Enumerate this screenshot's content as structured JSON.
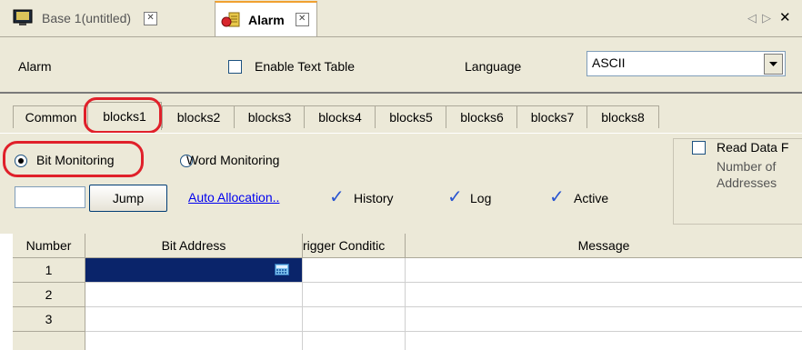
{
  "doc_tabs": [
    {
      "label": "Base 1(untitled)",
      "icon": "monitor-icon",
      "active": false
    },
    {
      "label": "Alarm",
      "icon": "alarm-icon",
      "active": true
    }
  ],
  "tab_nav": {
    "prev": "◁",
    "next": "▷",
    "close": "✕"
  },
  "settings": {
    "alarm_label": "Alarm",
    "enable_text_table_label": "Enable Text Table",
    "enable_text_table_checked": false,
    "language_label": "Language",
    "language_value": "ASCII"
  },
  "block_tabs": [
    "Common",
    "blocks1",
    "blocks2",
    "blocks3",
    "blocks4",
    "blocks5",
    "blocks6",
    "blocks7",
    "blocks8"
  ],
  "active_block_tab": "blocks1",
  "monitoring": {
    "bit_label": "Bit Monitoring",
    "word_label": "Word Monitoring",
    "selected": "bit"
  },
  "read_data": {
    "checkbox_label": "Read Data F",
    "number_of_label": "Number of",
    "addresses_label": "Addresses"
  },
  "toolbar": {
    "jump_input_value": "",
    "jump_label": "Jump",
    "auto_allocation_label": "Auto Allocation..",
    "history_label": "History",
    "log_label": "Log",
    "active_label": "Active",
    "history_checked": true,
    "log_checked": true,
    "active_checked": true
  },
  "grid": {
    "columns": [
      "Number",
      "Bit Address",
      "rigger Conditic",
      "Message"
    ],
    "rows": [
      {
        "number": "1",
        "bit_address": "",
        "trigger": "",
        "message": ""
      },
      {
        "number": "2",
        "bit_address": "",
        "trigger": "",
        "message": ""
      },
      {
        "number": "3",
        "bit_address": "",
        "trigger": "",
        "message": ""
      }
    ]
  },
  "colors": {
    "highlight": "#e0202a",
    "selected_cell": "#0a246a",
    "link": "#0000ee",
    "check": "#2a55d0"
  }
}
